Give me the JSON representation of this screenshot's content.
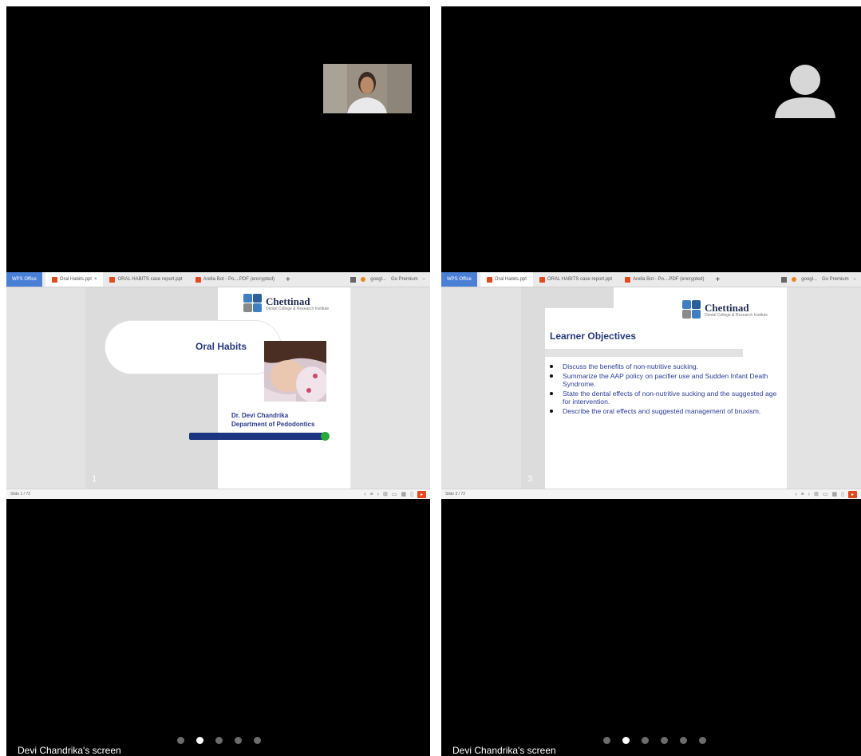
{
  "panels": [
    {
      "caption": "Devi Chandrika's screen",
      "dots": [
        false,
        true,
        false,
        false,
        false
      ],
      "browser": {
        "brand": "WPS Office",
        "tabs": [
          "Oral Habits.ppt",
          "ORAL HABITS case report.ppt",
          "Arella Bot - Po....PDF (encrypted)"
        ],
        "right": [
          "googl...",
          "Go Premium"
        ]
      },
      "status_left": "Slide 1 / 72",
      "slide": {
        "title": "Oral Habits",
        "author_name": "Dr. Devi Chandrika",
        "author_dept": "Department of Pedodontics",
        "number": "1",
        "logo_main": "Chettinad",
        "logo_sub": "Dental College & Research Institute"
      }
    },
    {
      "caption": "Devi Chandrika's screen",
      "dots": [
        false,
        true,
        false,
        false,
        false,
        false
      ],
      "browser": {
        "brand": "WPS Office",
        "tabs": [
          "Oral Habits.ppt",
          "ORAL HABITS case report.ppt",
          "Arella Bot - Po....PDF (encrypted)"
        ],
        "right": [
          "googl...",
          "Go Premium"
        ]
      },
      "status_left": "Slide 3 / 72",
      "slide": {
        "title": "Learner Objectives",
        "number": "3",
        "logo_main": "Chettinad",
        "logo_sub": "Dental College & Research Institute",
        "objectives": [
          "Discuss the benefits of non-nutritive sucking.",
          "Summarize the AAP policy on pacifier use and Sudden Infant Death Syndrome.",
          "State the dental effects of non-nutritive sucking and the suggested age for intervention.",
          "Describe the oral effects and suggested management of bruxism."
        ]
      }
    }
  ],
  "colors": {
    "accent_blue": "#263a7c",
    "wps_blue": "#4a7fd6",
    "wps_orange": "#e2491f",
    "progress_green": "#2aa83a"
  }
}
